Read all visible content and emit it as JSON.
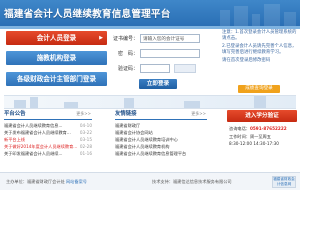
{
  "header": {
    "title": "福建省会计人员继续教育信息管理平台"
  },
  "nav": {
    "accountant_login": "会计人员登录",
    "school_login": "施教机构登录",
    "unit_login": "各级财政会计主管部门登录"
  },
  "login": {
    "cert_label": "证书编号：",
    "cert_placeholder": "请输入您的会计证号",
    "password_label": "密　码：",
    "code_label": "验证码：",
    "submit": "立即登录"
  },
  "tips": {
    "line1": "注意：1.首次登录会计人员管理系统的请点击。",
    "line2": "2.已登录会计人员请先完善个人信息，填写完善后进行继续教育学习。",
    "line3": "请在首次登录后修改密码",
    "score_button": "成绩查询登录"
  },
  "notice": {
    "title": "平台公告",
    "more": "更多>>",
    "items": [
      {
        "text": "福建省会计人员继续教育信息...",
        "date": "04-10",
        "red": false
      },
      {
        "text": "关于发布福建省会计人员继续教育...",
        "date": "03-22",
        "red": false
      },
      {
        "text": "新平台上线",
        "date": "03-15",
        "red": true
      },
      {
        "text": "关于做好2014年度会计人员继续教育...",
        "date": "02-28",
        "red": true
      },
      {
        "text": "关于印发福建省会计人员继续...",
        "date": "01-16",
        "red": false
      }
    ]
  },
  "links": {
    "title": "友情链接",
    "more": "更多>>",
    "items": [
      {
        "text": "福建省财政厅"
      },
      {
        "text": "福建省会计协会网站"
      },
      {
        "text": "福建省会计人员继续教育培训中心"
      },
      {
        "text": "福建省会计人员继续教育机构"
      },
      {
        "text": "福建省会计人员继续教育信息管理平台"
      }
    ]
  },
  "service": {
    "enter_button": "进入学分验证",
    "hotline_label": "咨询电话：",
    "hotline": "0591-87652222",
    "time_label": "工作时间：",
    "time": "周一至周五",
    "hours": "8:30-12:00 14:30-17:30"
  },
  "footer": {
    "left": "主办单位：福建省财政厅会计处",
    "left_link": "网站备案号",
    "right": "技术支持：福建信达信息技术服务有限公司",
    "badge": "福建省财政会计信息网"
  },
  "colors": {
    "header": "#2a6fb5",
    "accent_red": "#c62b12",
    "accent_blue": "#2f72b8",
    "orange": "#f0a21c"
  }
}
